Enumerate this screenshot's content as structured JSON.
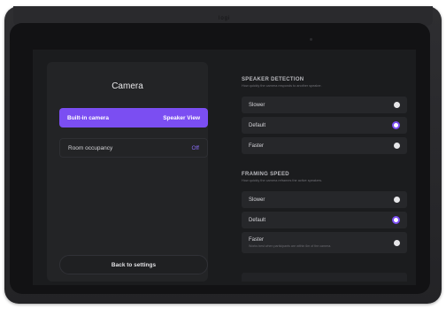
{
  "device": {
    "brand": "logi"
  },
  "left_panel": {
    "title": "Camera",
    "rows": [
      {
        "label": "Built-in camera",
        "value": "Speaker View"
      },
      {
        "label": "Room occupancy",
        "value": "Off"
      }
    ],
    "back_label": "Back to settings"
  },
  "speaker_detection": {
    "title": "SPEAKER DETECTION",
    "subtitle": "How quickly the camera responds to another speaker.",
    "options": [
      {
        "label": "Slower",
        "selected": false
      },
      {
        "label": "Default",
        "selected": true
      },
      {
        "label": "Faster",
        "selected": false
      }
    ]
  },
  "framing_speed": {
    "title": "FRAMING SPEED",
    "subtitle": "How quickly the camera reframes the active speakers.",
    "options": [
      {
        "label": "Slower",
        "selected": false
      },
      {
        "label": "Default",
        "selected": true
      },
      {
        "label": "Faster",
        "note": "Works best when participants are within 6m of the camera.",
        "selected": false
      }
    ]
  },
  "colors": {
    "accent": "#7b4ef2",
    "screen_bg": "#1b1c1e",
    "panel_bg": "#232426"
  }
}
